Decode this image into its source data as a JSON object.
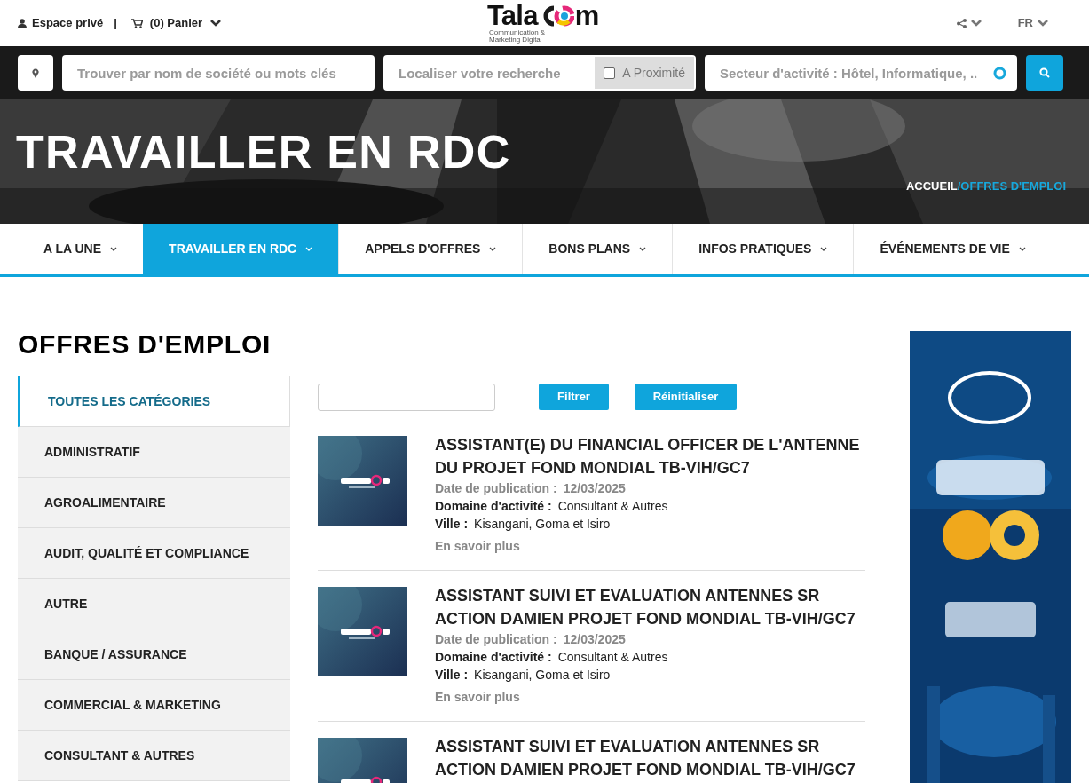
{
  "top_bar": {
    "account": "Espace privé",
    "separator": "|",
    "cart": "(0) Panier",
    "language": "FR"
  },
  "logo": {
    "before": "Tala",
    "after": "m",
    "tagline": "Communication & Marketing Digital"
  },
  "search": {
    "keywords_placeholder": "Trouver par nom de société ou mots clés",
    "location_placeholder": "Localiser votre recherche",
    "nearby": {
      "label": "A Proximité",
      "checked": false
    },
    "sector_placeholder": "Secteur d'activité : Hôtel, Informatique, .."
  },
  "hero": {
    "title": "TRAVAILLER EN RDC",
    "breadcrumb": [
      {
        "label": "ACCUEIL",
        "selected": false
      },
      {
        "label": "/OFFRES D'EMPLOI",
        "selected": true
      }
    ]
  },
  "nav": [
    {
      "label": "A LA UNE",
      "selected": false
    },
    {
      "label": "TRAVAILLER EN RDC",
      "selected": true
    },
    {
      "label": "APPELS D'OFFRES",
      "selected": false
    },
    {
      "label": "BONS PLANS",
      "selected": false
    },
    {
      "label": "INFOS PRATIQUES",
      "selected": false
    },
    {
      "label": "ÉVÉNEMENTS DE VIE",
      "selected": false
    }
  ],
  "page_title": "OFFRES D'EMPLOI",
  "categories": [
    {
      "label": "TOUTES LES CATÉGORIES",
      "selected": true
    },
    {
      "label": "ADMINISTRATIF",
      "selected": false
    },
    {
      "label": "AGROALIMENTAIRE",
      "selected": false
    },
    {
      "label": "AUDIT, QUALITÉ ET COMPLIANCE",
      "selected": false
    },
    {
      "label": "AUTRE",
      "selected": false
    },
    {
      "label": "BANQUE / ASSURANCE",
      "selected": false
    },
    {
      "label": "COMMERCIAL & MARKETING",
      "selected": false
    },
    {
      "label": "CONSULTANT & AUTRES",
      "selected": false
    }
  ],
  "filter": {
    "filter_button": "Filtrer",
    "reset_button": "Réinitialiser"
  },
  "jobs": [
    {
      "title": "ASSISTANT(E) DU FINANCIAL OFFICER DE L'ANTENNE DU PROJET FOND MONDIAL TB-VIH/GC7",
      "date_label": "Date de publication :",
      "date": "12/03/2025",
      "domain_label": "Domaine d'activité :",
      "domain": "Consultant & Autres",
      "city_label": "Ville :",
      "city": "Kisangani, Goma et Isiro",
      "more": "En savoir plus"
    },
    {
      "title": "ASSISTANT SUIVI ET EVALUATION ANTENNES SR ACTION DAMIEN PROJET FOND MONDIAL TB-VIH/GC7",
      "date_label": "Date de publication :",
      "date": "12/03/2025",
      "domain_label": "Domaine d'activité :",
      "domain": "Consultant & Autres",
      "city_label": "Ville :",
      "city": "Kisangani, Goma et Isiro",
      "more": "En savoir plus"
    },
    {
      "title": "ASSISTANT SUIVI ET EVALUATION ANTENNES SR ACTION DAMIEN PROJET FOND MONDIAL TB-VIH/GC7"
    }
  ]
}
